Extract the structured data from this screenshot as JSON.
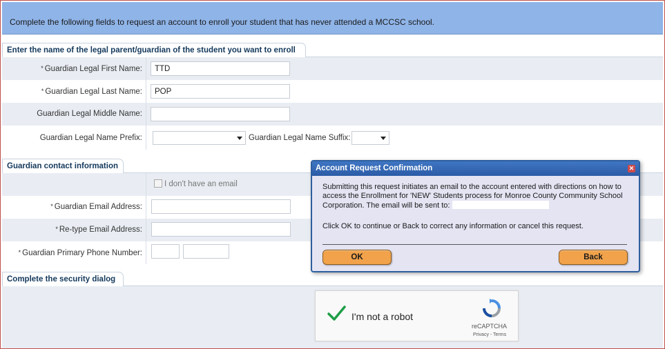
{
  "banner": {
    "text": "Complete the following fields to request an account to enroll your student that has never attended a MCCSC school."
  },
  "guardian_section": {
    "title": "Enter the name of the legal parent/guardian of the student you want to enroll",
    "required_mark": "*",
    "first_name": {
      "label": "Guardian Legal First Name:",
      "value": "TTD"
    },
    "last_name": {
      "label": "Guardian Legal Last Name:",
      "value": "POP"
    },
    "middle_name": {
      "label": "Guardian Legal Middle Name:",
      "value": ""
    },
    "prefix": {
      "label": "Guardian Legal Name Prefix:",
      "value": ""
    },
    "suffix": {
      "label": "Guardian Legal Name Suffix:",
      "value": ""
    }
  },
  "contact_section": {
    "title": "Guardian contact information",
    "no_email_label": "I don't have an email",
    "email": {
      "label": "Guardian Email Address:",
      "value": ""
    },
    "retype_email": {
      "label": "Re-type Email Address:",
      "value": ""
    },
    "phone": {
      "label": "Guardian Primary Phone Number:",
      "area_code": "",
      "number": ""
    }
  },
  "security_section": {
    "title": "Complete the security dialog",
    "captcha_label": "I'm not a robot",
    "captcha_brand": "reCAPTCHA",
    "captcha_terms": "Privacy - Terms"
  },
  "dialog": {
    "title": "Account Request Confirmation",
    "close_icon": "close-icon",
    "message": "Submitting this request initiates an email to the account entered with directions on how to access the Enrollment for 'NEW' Students process for Monroe County Community School Corporation. The email will be sent to:",
    "message2": "Click OK to continue or Back to correct any information or cancel this request.",
    "ok_label": "OK",
    "back_label": "Back"
  },
  "colors": {
    "banner": "#8fb4e8",
    "dialog_title": "#2c5ba6",
    "button": "#f1a24a",
    "row_alt": "#e9edf3"
  }
}
